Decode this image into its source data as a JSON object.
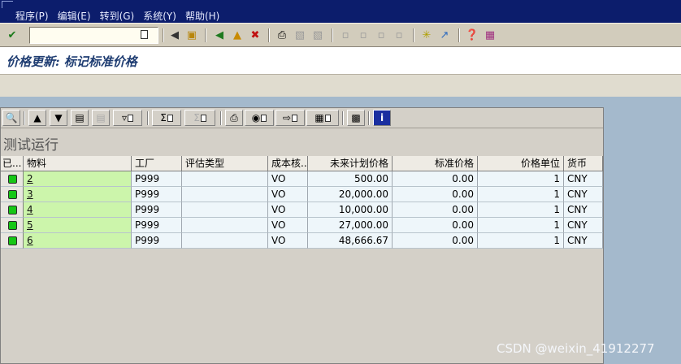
{
  "menu": {
    "items": [
      "程序(P)",
      "编辑(E)",
      "转到(G)",
      "系统(Y)",
      "帮助(H)"
    ]
  },
  "toolbar": {
    "command_value": ""
  },
  "page": {
    "title": "价格更新: 标记标准价格"
  },
  "grid": {
    "title": "测试运行",
    "columns": [
      "已...",
      "物料",
      "工厂",
      "评估类型",
      "成本核...",
      "未来计划价格",
      "标准价格",
      "价格单位",
      "货币"
    ],
    "rows": [
      [
        "",
        "2",
        "P999",
        "",
        "VO",
        "500.00",
        "0.00",
        "1",
        "CNY"
      ],
      [
        "",
        "3",
        "P999",
        "",
        "VO",
        "20,000.00",
        "0.00",
        "1",
        "CNY"
      ],
      [
        "",
        "4",
        "P999",
        "",
        "VO",
        "10,000.00",
        "0.00",
        "1",
        "CNY"
      ],
      [
        "",
        "5",
        "P999",
        "",
        "VO",
        "27,000.00",
        "0.00",
        "1",
        "CNY"
      ],
      [
        "",
        "6",
        "P999",
        "",
        "VO",
        "48,666.67",
        "0.00",
        "1",
        "CNY"
      ]
    ],
    "status_light": "green",
    "colors": {
      "key_column": "#ccf5ab",
      "row_bg": "#eef6fa",
      "led": "#16c716"
    }
  },
  "watermark": "CSDN @weixin_41912277",
  "colors": {
    "menubar": "#0c1d6c",
    "title_text": "#1f3d72",
    "background": "#a4b9cc"
  }
}
